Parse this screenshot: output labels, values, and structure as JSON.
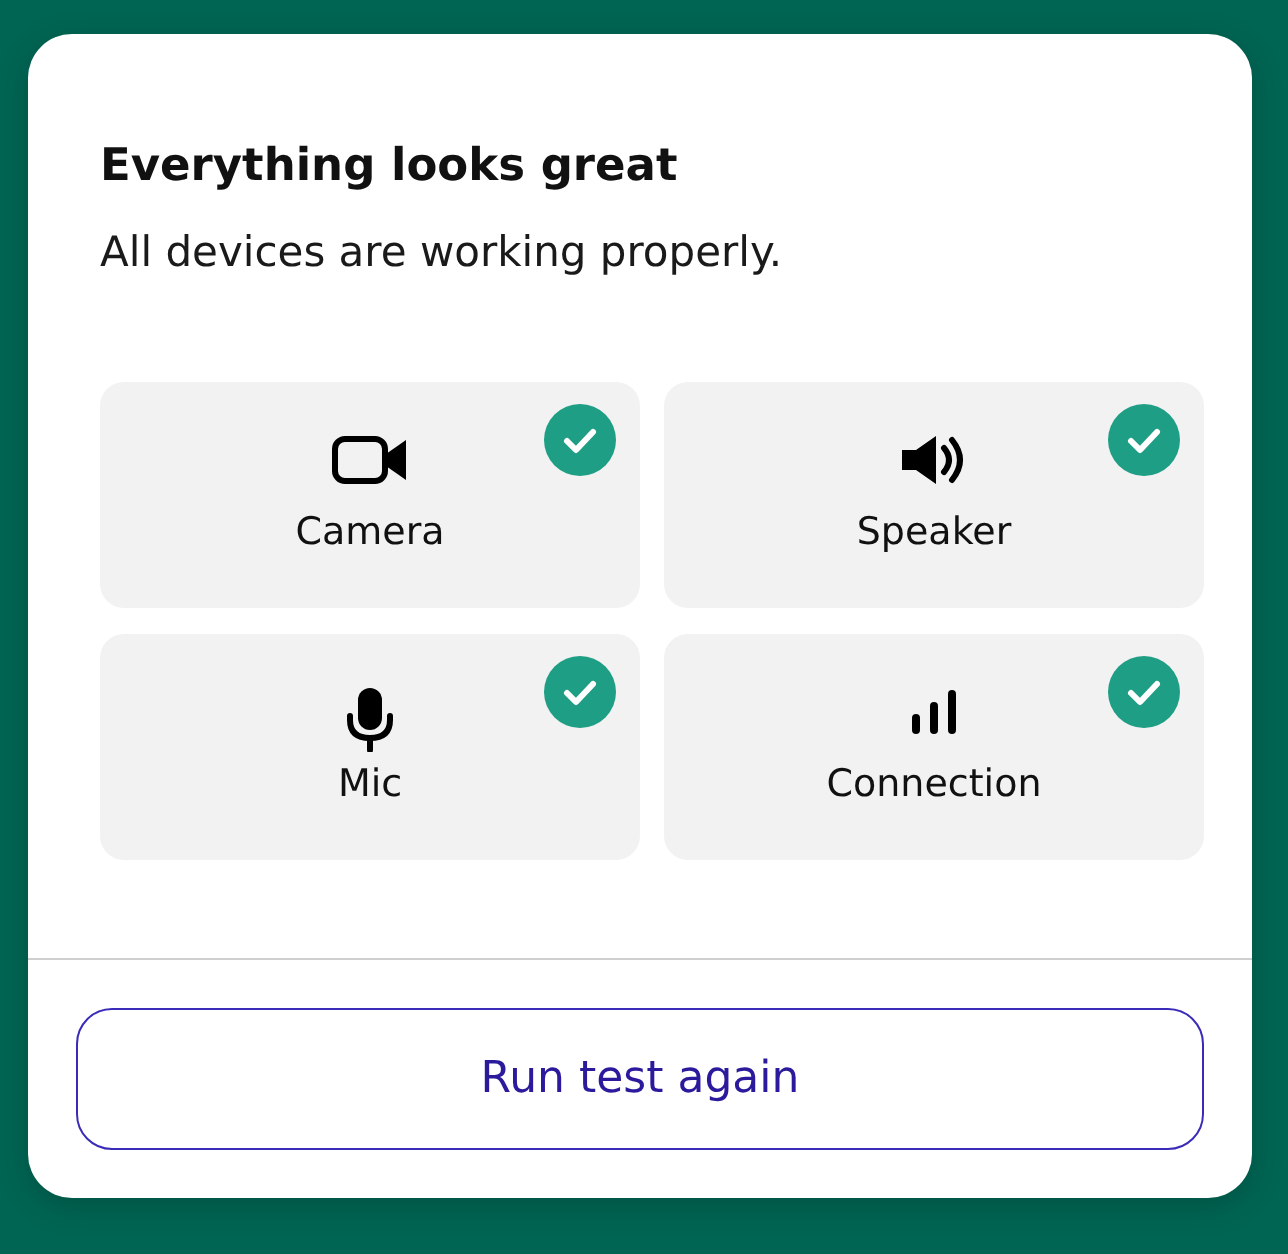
{
  "dialog": {
    "title": "Everything looks great",
    "subtitle": "All devices are working properly."
  },
  "devices": [
    {
      "kind": "camera",
      "label": "Camera",
      "working": true
    },
    {
      "kind": "speaker",
      "label": "Speaker",
      "working": true
    },
    {
      "kind": "mic",
      "label": "Mic",
      "working": true
    },
    {
      "kind": "connection",
      "label": "Connection",
      "working": true
    }
  ],
  "button": {
    "label": "Run test again"
  }
}
